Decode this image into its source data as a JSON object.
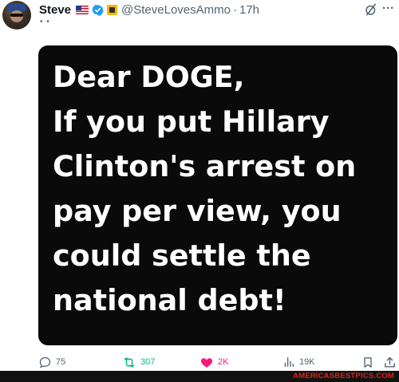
{
  "tweet": {
    "author_name": "Steve",
    "handle": "@SteveLovesAmmo",
    "separator": "·",
    "time": "17h",
    "sub_label": "• •",
    "more_label": "···",
    "image_lines": [
      "Dear DOGE,",
      "If you put Hillary",
      "Clinton's arrest on",
      "pay per view, you",
      "could settle the",
      "national debt!"
    ]
  },
  "actions": {
    "reply_count": "75",
    "retweet_count": "307",
    "like_count": "2K",
    "views_count": "19K"
  },
  "watermark": "AMERICASBESTPICS.COM",
  "colors": {
    "verified": "#1d9bf0",
    "retweet": "#00ba7c",
    "like": "#f91880",
    "muted": "#536471",
    "watermark": "#e2231a"
  },
  "icons": {
    "reply": "reply-icon",
    "retweet": "retweet-icon",
    "like": "heart-icon",
    "views": "views-icon",
    "bookmark": "bookmark-icon",
    "share": "share-icon",
    "grok": "grok-icon",
    "more": "more-icon"
  }
}
